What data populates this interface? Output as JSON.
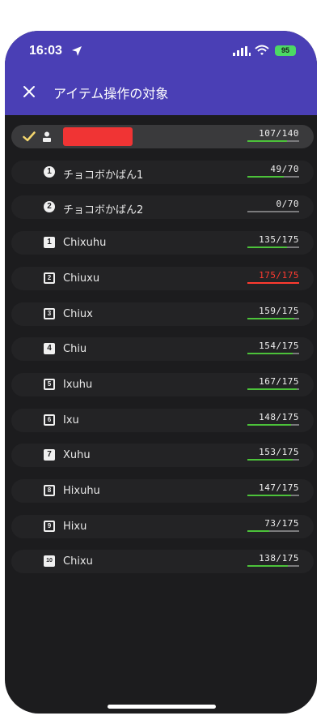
{
  "status_bar": {
    "time": "16:03",
    "battery": "95"
  },
  "header": {
    "title": "アイテム操作の対象",
    "close_icon": "close-icon"
  },
  "colors": {
    "header_bg": "#4a3fb5",
    "bar_green": "#4cc23a",
    "bar_full": "#ff3b30",
    "redacted": "#f03434"
  },
  "selected_row": {
    "count": "107/140",
    "fill": 0.764
  },
  "bags": [
    {
      "icon_text": "1",
      "label": "チョコボかばん1",
      "count": "49/70",
      "fill": 0.7
    },
    {
      "icon_text": "2",
      "label": "チョコボかばん2",
      "count": "0/70",
      "fill": 0.0
    }
  ],
  "retainers": [
    {
      "icon_text": "1",
      "label": "Chixuhu",
      "count": "135/175",
      "fill": 0.771,
      "full": false
    },
    {
      "icon_text": "2",
      "label": "Chiuxu",
      "count": "175/175",
      "fill": 1.0,
      "full": true
    },
    {
      "icon_text": "3",
      "label": "Chiux",
      "count": "159/175",
      "fill": 0.909,
      "full": false
    },
    {
      "icon_text": "4",
      "label": "Chiu",
      "count": "154/175",
      "fill": 0.88,
      "full": false
    },
    {
      "icon_text": "5",
      "label": "Ixuhu",
      "count": "167/175",
      "fill": 0.954,
      "full": false
    },
    {
      "icon_text": "6",
      "label": "Ixu",
      "count": "148/175",
      "fill": 0.846,
      "full": false
    },
    {
      "icon_text": "7",
      "label": "Xuhu",
      "count": "153/175",
      "fill": 0.874,
      "full": false
    },
    {
      "icon_text": "8",
      "label": "Hixuhu",
      "count": "147/175",
      "fill": 0.84,
      "full": false
    },
    {
      "icon_text": "9",
      "label": "Hixu",
      "count": "73/175",
      "fill": 0.417,
      "full": false
    },
    {
      "icon_text": "10",
      "label": "Chixu",
      "count": "138/175",
      "fill": 0.789,
      "full": false
    }
  ]
}
